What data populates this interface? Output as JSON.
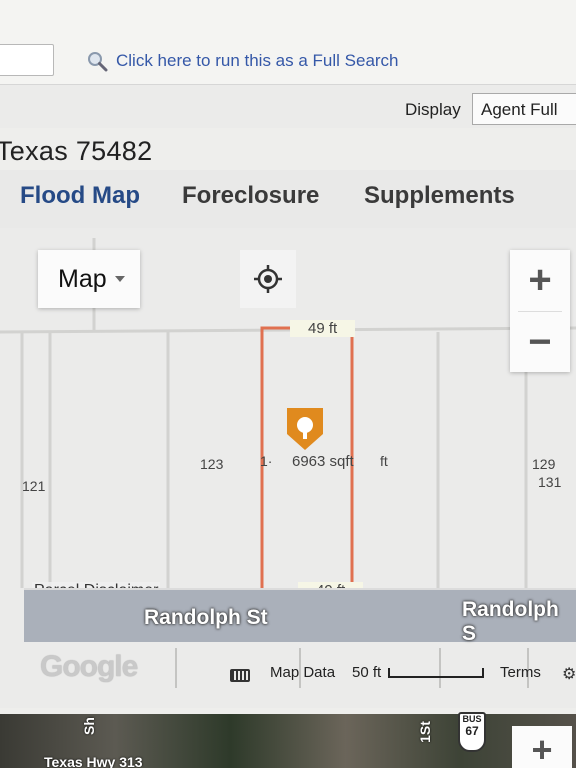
{
  "header": {
    "full_search_text": "Click here to run this as a Full Search",
    "display_label": "Display",
    "display_value": "Agent Full"
  },
  "address": "Texas 75482",
  "tabs": [
    {
      "label": "Flood Map",
      "active": true
    },
    {
      "label": "Foreclosure",
      "active": false
    },
    {
      "label": "Supplements",
      "active": false
    }
  ],
  "map": {
    "type_button": "Map",
    "zoom_in": "+",
    "zoom_out": "−",
    "parcel": {
      "top_dim": "49 ft",
      "bottom_dim": "49 ft",
      "area": "6963 sqft",
      "left_dim": "1·",
      "right_dim": "ft"
    },
    "lot_numbers": [
      "123",
      "121",
      "129",
      "131"
    ],
    "parcel_disclaimer": "Parcel Disclaimer",
    "street": "Randolph St",
    "street_right": "Randolph S",
    "attribution": {
      "logo": "Google",
      "map_data": "Map Data",
      "scale": "50 ft",
      "terms": "Terms"
    },
    "satellite": {
      "road_label": "Texas Hwy 313",
      "side_text_1": "Sh",
      "side_text_2": "1St",
      "shield_top": "BUS",
      "shield_num": "67",
      "zoom_in": "+"
    }
  },
  "colors": {
    "tab_active": "#264a86",
    "parcel_outline": "#e07050",
    "pin": "#e08a1e",
    "link": "#3558a8"
  }
}
